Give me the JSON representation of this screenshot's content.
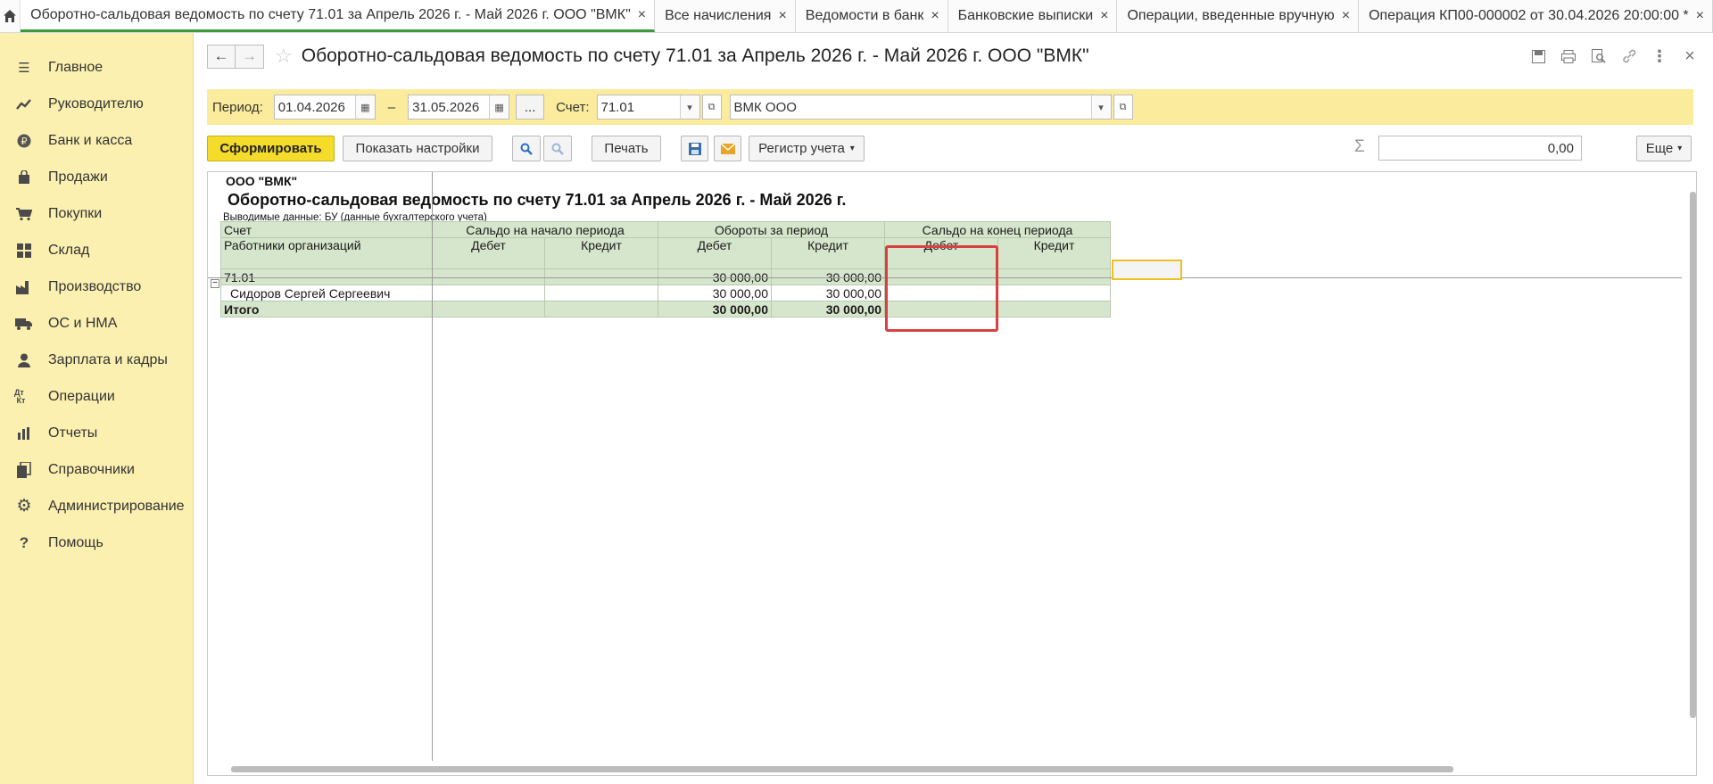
{
  "tabs": [
    {
      "label": "Оборотно-сальдовая ведомость по счету 71.01 за Апрель 2026 г. - Май 2026 г. ООО \"ВМК\"",
      "active": true
    },
    {
      "label": "Все начисления"
    },
    {
      "label": "Ведомости в банк"
    },
    {
      "label": "Банковские выписки"
    },
    {
      "label": "Операции, введенные вручную"
    },
    {
      "label": "Операция КП00-000002 от 30.04.2026 20:00:00 *"
    }
  ],
  "sidebar": {
    "items": [
      {
        "label": "Главное",
        "icon": "menu-icon"
      },
      {
        "label": "Руководителю",
        "icon": "trend-icon"
      },
      {
        "label": "Банк и касса",
        "icon": "ruble-icon"
      },
      {
        "label": "Продажи",
        "icon": "bag-icon"
      },
      {
        "label": "Покупки",
        "icon": "cart-icon"
      },
      {
        "label": "Склад",
        "icon": "warehouse-icon"
      },
      {
        "label": "Производство",
        "icon": "factory-icon"
      },
      {
        "label": "ОС и НМА",
        "icon": "truck-icon"
      },
      {
        "label": "Зарплата и кадры",
        "icon": "person-icon"
      },
      {
        "label": "Операции",
        "icon": "dt-kt-icon"
      },
      {
        "label": "Отчеты",
        "icon": "bar-chart-icon"
      },
      {
        "label": "Справочники",
        "icon": "books-icon"
      },
      {
        "label": "Администрирование",
        "icon": "gear-icon"
      },
      {
        "label": "Помощь",
        "icon": "question-icon"
      }
    ]
  },
  "header": {
    "title": "Оборотно-сальдовая ведомость по счету 71.01 за Апрель 2026 г. - Май 2026 г. ООО \"ВМК\""
  },
  "filters": {
    "period_label": "Период:",
    "date_from": "01.04.2026",
    "dash": "–",
    "date_to": "31.05.2026",
    "dots": "...",
    "account_label": "Счет:",
    "account": "71.01",
    "organization": "ВМК ООО"
  },
  "commands": {
    "generate": "Сформировать",
    "show_settings": "Показать настройки",
    "print": "Печать",
    "register": "Регистр учета",
    "sum_symbol": "Σ",
    "sum_value": "0,00",
    "more": "Еще"
  },
  "report": {
    "org": "ООО \"ВМК\"",
    "title": "Оборотно-сальдовая ведомость по счету 71.01 за Апрель 2026 г. - Май 2026 г.",
    "output_data": "Выводимые данные: БУ (данные бухгалтерского учета)",
    "headers": {
      "account": "Счет",
      "employees": "Работники организаций",
      "opening": "Сальдо на начало периода",
      "turnover": "Обороты за период",
      "closing": "Сальдо на конец периода",
      "debit": "Дебет",
      "credit": "Кредит"
    },
    "rows": [
      {
        "name": "71.01",
        "open_dt": "",
        "open_kt": "",
        "turn_dt": "30 000,00",
        "turn_kt": "30 000,00",
        "close_dt": "",
        "close_kt": ""
      },
      {
        "name": "Сидоров Сергей Сергеевич",
        "open_dt": "",
        "open_kt": "",
        "turn_dt": "30 000,00",
        "turn_kt": "30 000,00",
        "close_dt": "",
        "close_kt": ""
      },
      {
        "name": "Итого",
        "open_dt": "",
        "open_kt": "",
        "turn_dt": "30 000,00",
        "turn_kt": "30 000,00",
        "close_dt": "",
        "close_kt": ""
      }
    ]
  }
}
